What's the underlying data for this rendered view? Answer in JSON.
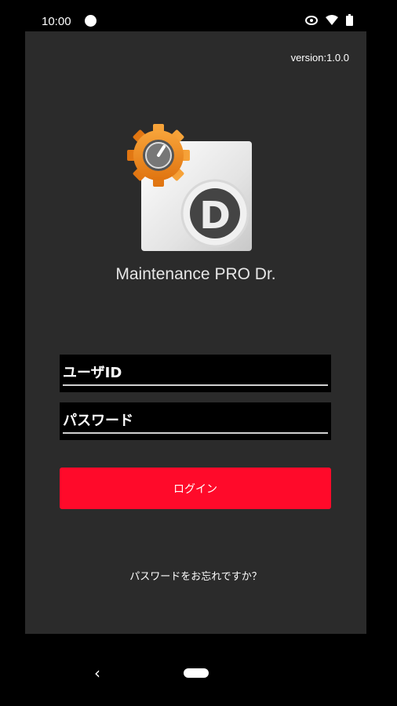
{
  "status_bar": {
    "time": "10:00",
    "icons": [
      "app-notification-icon",
      "eye-icon",
      "wifi-icon",
      "battery-icon"
    ]
  },
  "app": {
    "version": "version:1.0.0",
    "name": "Maintenance PRO Dr.",
    "logo_letter": "D"
  },
  "form": {
    "user_id_placeholder": "ユーザID",
    "password_placeholder": "パスワード",
    "login_label": "ログイン",
    "forgot_label": "パスワードをお忘れですか？"
  },
  "colors": {
    "background": "#2b2b2b",
    "accent": "#ff0a2a",
    "gear": "#f0891f"
  },
  "nav": {
    "back_glyph": "‹"
  }
}
